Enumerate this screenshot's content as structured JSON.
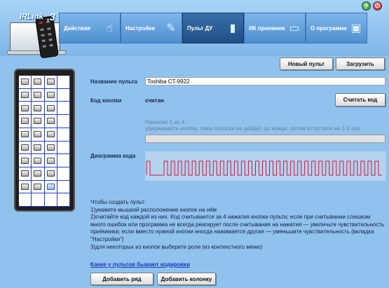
{
  "app": {
    "logo_text": "IRLink",
    "logo_version": ".3"
  },
  "top_icons": {
    "help": "?",
    "power": "⏻"
  },
  "tabs": [
    {
      "label": "Действия",
      "icon": "hand-icon",
      "active": false
    },
    {
      "label": "Настройки",
      "icon": "tools-icon",
      "active": false
    },
    {
      "label": "Пульт ДУ",
      "icon": "remote-icon",
      "active": true
    },
    {
      "label": "ИК приемник",
      "icon": "usb-receiver-icon",
      "active": false
    },
    {
      "label": "О программе",
      "icon": "computer-icon",
      "active": false
    }
  ],
  "toolbar": {
    "new_remote": "Новый пульт",
    "load": "Загрузить"
  },
  "form": {
    "name_label": "Название пульта",
    "name_value": "Toshiba CT-9922",
    "code_label": "Код кнопки",
    "code_status": "считан",
    "read_code_button": "Считать код",
    "press_counter": "Нажатие 1 из 4:",
    "press_hint": "удерживайте кнопку, пока полоска не дойдёт до конца, потом отпустите на 1-2 сек.",
    "progress": 0,
    "diagram_label": "Диаграмма кода"
  },
  "instructions": [
    "Чтобы создать пульт:",
    "1)укажите мышкой расположение кнопок на нём",
    "2)считайте код каждой из них. Код считывается за 4 нажатия кнопки пульта; если при считывании слишком много ошибок или программа не всегда реагирует после считывания на нажатия — увеличьте чувствительность приёмника; если вместо нужной кнопки иногда нажимается другая — уменьшите чувствительность (вкладка \"Настройки\")",
    "3)для некоторых из кнопок выберете роли (из контекстного меню)"
  ],
  "link_text": "Какие у пультов бывают кодировки",
  "bottom_buttons": {
    "add_row": "Добавить ряд",
    "add_column": "Добавить колонку"
  },
  "remote_grid": {
    "columns": 4,
    "rows": 10,
    "keys_per_row": [
      3,
      3,
      3,
      3,
      3,
      3,
      3,
      3,
      3,
      0
    ],
    "selected_key": {
      "row": 8,
      "col": 2
    }
  },
  "colors": {
    "background": "#8fc3ee",
    "active_tab": "#1e4f86",
    "grid_line": "#1d3ecc",
    "signal": "#d2143c",
    "link": "#2233bb"
  },
  "signal_pattern": [
    1,
    4,
    1,
    1,
    1,
    1,
    1,
    1,
    1,
    1,
    1,
    1,
    1,
    1,
    1,
    1,
    1,
    1,
    1,
    1,
    1,
    1,
    1,
    1,
    1,
    1,
    1,
    1,
    1,
    1,
    1,
    1,
    1,
    1,
    1,
    1,
    1,
    1,
    1,
    1,
    1,
    1,
    1,
    1,
    1,
    1,
    1,
    1,
    1,
    1,
    1,
    1,
    1,
    1,
    1,
    1,
    1,
    1,
    1,
    1,
    1,
    1,
    1,
    1
  ]
}
